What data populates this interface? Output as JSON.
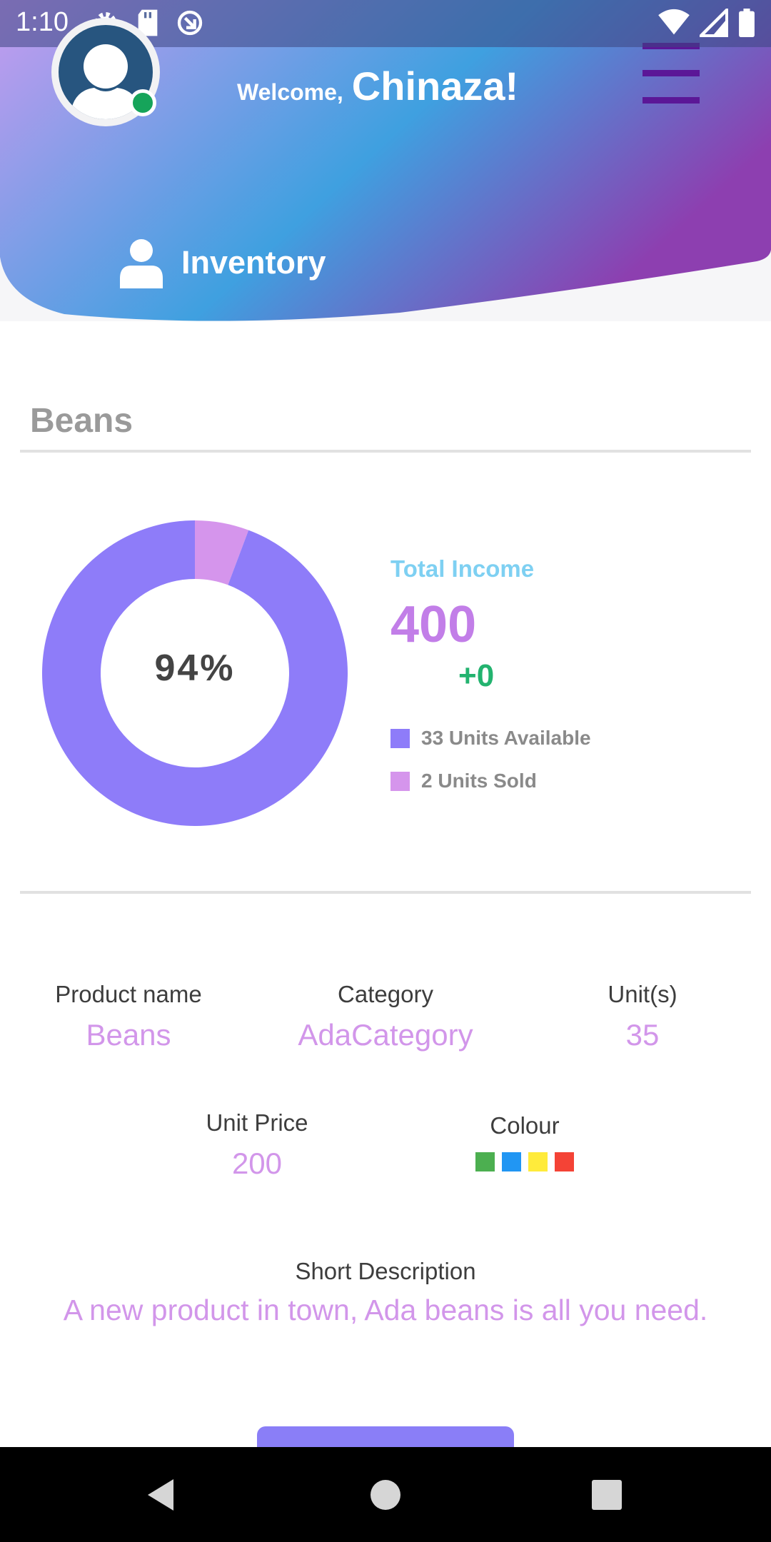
{
  "status_bar": {
    "time": "1:10",
    "left_icons": [
      "gear-icon",
      "sd-card-icon",
      "sync-icon"
    ],
    "right_icons": [
      "wifi-icon",
      "signal-icon",
      "battery-icon"
    ]
  },
  "header": {
    "welcome_text": "Welcome,",
    "user_name": "Chinaza!",
    "section_label": "Inventory",
    "online_status_color": "#16a45a",
    "gradient_colors": [
      "#c59bef",
      "#3fa0e0",
      "#8d3fb0"
    ]
  },
  "product_card": {
    "title": "Beans"
  },
  "chart_data": {
    "type": "pie",
    "style": "donut",
    "center_label": "94%",
    "slices": [
      {
        "label": "33 Units Available",
        "value": 33,
        "color": "#8e7cf9"
      },
      {
        "label": "2 Units Sold",
        "value": 2,
        "color": "#d595ec"
      }
    ]
  },
  "income": {
    "label": "Total Income",
    "value": "400",
    "delta": "+0"
  },
  "legend": [
    {
      "text": "33 Units Available",
      "color": "#8e7cf9"
    },
    {
      "text": "2 Units Sold",
      "color": "#d595ec"
    }
  ],
  "details": {
    "product_name": {
      "label": "Product name",
      "value": "Beans"
    },
    "category": {
      "label": "Category",
      "value": "AdaCategory"
    },
    "units": {
      "label": "Unit(s)",
      "value": "35"
    },
    "unit_price": {
      "label": "Unit Price",
      "value": "200"
    },
    "colour": {
      "label": "Colour",
      "swatches": [
        "#4caf50",
        "#2196f3",
        "#ffeb3b",
        "#f44336"
      ]
    },
    "short_description": {
      "label": "Short Description",
      "value": "A new product in town, Ada beans is all you need."
    }
  },
  "nav_bar": {
    "buttons": [
      "back-icon",
      "home-icon",
      "recents-icon"
    ]
  }
}
